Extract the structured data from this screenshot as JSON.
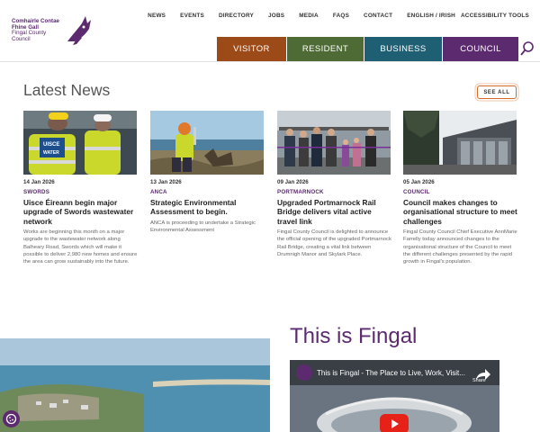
{
  "logo": {
    "line1": "Comhairle Contae",
    "line2": "Fhine Gall",
    "line3": "Fingal County",
    "line4": "Council"
  },
  "topnav": [
    "NEWS",
    "EVENTS",
    "DIRECTORY",
    "JOBS",
    "MEDIA",
    "FAQS",
    "CONTACT",
    "ENGLISH / IRISH",
    "ACCESSIBILITY TOOLS"
  ],
  "mainnav": {
    "visitor": "VISITOR",
    "resident": "RESIDENT",
    "business": "BUSINESS",
    "council": "COUNCIL"
  },
  "news": {
    "title": "Latest News",
    "see_all": "SEE ALL",
    "cards": [
      {
        "date": "14 Jan 2026",
        "category": "SWORDS",
        "headline": "Uisce Éireann begin major upgrade of Swords wastewater network",
        "excerpt": "Works are beginning this month on a major upgrade to the wastewater network along Balheary Road, Swords which will make it possible to deliver 2,980 new homes and ensure the area can grow sustainably into the future."
      },
      {
        "date": "13 Jan 2026",
        "category": "ANCA",
        "headline": "Strategic Environmental Assessment to begin.",
        "excerpt": "ANCA is proceeding to undertake a Strategic Environmental Assessment"
      },
      {
        "date": "09 Jan 2026",
        "category": "PORTMARNOCK",
        "headline": "Upgraded Portmarnock Rail Bridge delivers vital active travel link",
        "excerpt": "Fingal County Council is delighted to announce the official opening of the upgraded Portmarnock Rail Bridge, creating a vital link between Drumnigh Manor and Skylark Place."
      },
      {
        "date": "05 Jan 2026",
        "category": "COUNCIL",
        "headline": "Council makes changes to organisational structure to meet challenges",
        "excerpt": "Fingal County Council Chief Executive AnnMarie Farrelly today announced changes to the organisational structure of the Council to meet the different challenges presented by the rapid growth in Fingal's population."
      }
    ]
  },
  "fingal": {
    "title": "This is Fingal",
    "video_title": "This is Fingal - The Place to Live, Work, Visit...",
    "share_label": "Share"
  },
  "colors": {
    "visitor": "#9c4a18",
    "resident": "#4f6b35",
    "business": "#1f5f73",
    "council": "#5c2b6f",
    "accent": "#d46a2c"
  }
}
